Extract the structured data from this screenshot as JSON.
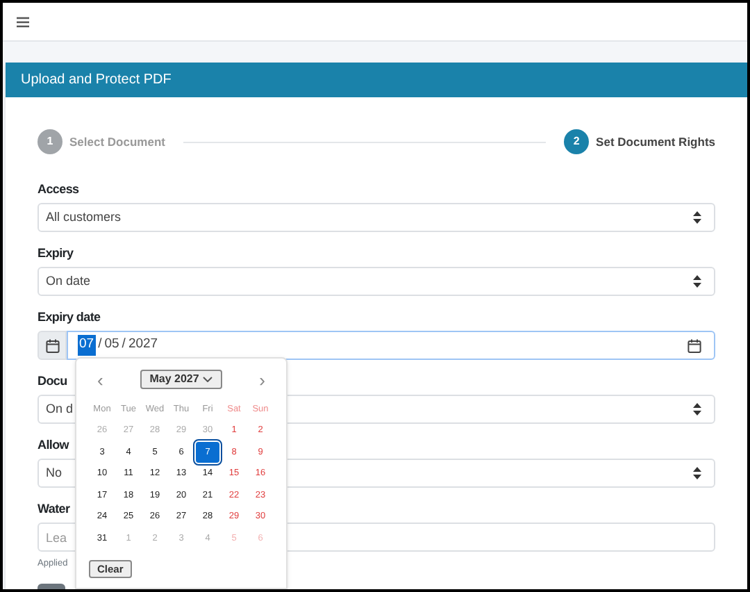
{
  "page_title": "Upload and Protect PDF",
  "steps": [
    {
      "number": "1",
      "label": "Select Document",
      "selected": false
    },
    {
      "number": "2",
      "label": "Set Document Rights",
      "selected": true
    }
  ],
  "fields": [
    {
      "kind": "select",
      "label": "Access",
      "value": "All customers"
    },
    {
      "kind": "select",
      "label": "Expiry",
      "value": "On date"
    },
    {
      "kind": "date",
      "label": "Expiry date",
      "separator": "/",
      "segments": [
        {
          "text": "07",
          "selected": true
        },
        {
          "text": "05",
          "selected": false
        },
        {
          "text": "2027",
          "selected": false
        }
      ]
    },
    {
      "kind": "select",
      "label": "Docu",
      "value": "On d"
    },
    {
      "kind": "select",
      "label": "Allow",
      "value": "No"
    },
    {
      "kind": "text",
      "label": "Water",
      "placeholder": "Lea",
      "help": "Applied"
    }
  ],
  "calendar": {
    "prev": "‹",
    "next": "›",
    "month": "May 2027",
    "clear": "Clear",
    "weekdays": [
      {
        "label": "Mon",
        "weekend": false
      },
      {
        "label": "Tue",
        "weekend": false
      },
      {
        "label": "Wed",
        "weekend": false
      },
      {
        "label": "Thu",
        "weekend": false
      },
      {
        "label": "Fri",
        "weekend": false
      },
      {
        "label": "Sat",
        "weekend": true
      },
      {
        "label": "Sun",
        "weekend": true
      }
    ],
    "days": [
      {
        "day": "26",
        "outside": true,
        "weekend": false,
        "selected": false
      },
      {
        "day": "27",
        "outside": true,
        "weekend": false,
        "selected": false
      },
      {
        "day": "28",
        "outside": true,
        "weekend": false,
        "selected": false
      },
      {
        "day": "29",
        "outside": true,
        "weekend": false,
        "selected": false
      },
      {
        "day": "30",
        "outside": true,
        "weekend": false,
        "selected": false
      },
      {
        "day": "1",
        "outside": false,
        "weekend": true,
        "selected": false
      },
      {
        "day": "2",
        "outside": false,
        "weekend": true,
        "selected": false
      },
      {
        "day": "3",
        "outside": false,
        "weekend": false,
        "selected": false
      },
      {
        "day": "4",
        "outside": false,
        "weekend": false,
        "selected": false
      },
      {
        "day": "5",
        "outside": false,
        "weekend": false,
        "selected": false
      },
      {
        "day": "6",
        "outside": false,
        "weekend": false,
        "selected": false
      },
      {
        "day": "7",
        "outside": false,
        "weekend": false,
        "selected": true
      },
      {
        "day": "8",
        "outside": false,
        "weekend": true,
        "selected": false
      },
      {
        "day": "9",
        "outside": false,
        "weekend": true,
        "selected": false
      },
      {
        "day": "10",
        "outside": false,
        "weekend": false,
        "selected": false
      },
      {
        "day": "11",
        "outside": false,
        "weekend": false,
        "selected": false
      },
      {
        "day": "12",
        "outside": false,
        "weekend": false,
        "selected": false
      },
      {
        "day": "13",
        "outside": false,
        "weekend": false,
        "selected": false
      },
      {
        "day": "14",
        "outside": false,
        "weekend": false,
        "selected": false
      },
      {
        "day": "15",
        "outside": false,
        "weekend": true,
        "selected": false
      },
      {
        "day": "16",
        "outside": false,
        "weekend": true,
        "selected": false
      },
      {
        "day": "17",
        "outside": false,
        "weekend": false,
        "selected": false
      },
      {
        "day": "18",
        "outside": false,
        "weekend": false,
        "selected": false
      },
      {
        "day": "19",
        "outside": false,
        "weekend": false,
        "selected": false
      },
      {
        "day": "20",
        "outside": false,
        "weekend": false,
        "selected": false
      },
      {
        "day": "21",
        "outside": false,
        "weekend": false,
        "selected": false
      },
      {
        "day": "22",
        "outside": false,
        "weekend": true,
        "selected": false
      },
      {
        "day": "23",
        "outside": false,
        "weekend": true,
        "selected": false
      },
      {
        "day": "24",
        "outside": false,
        "weekend": false,
        "selected": false
      },
      {
        "day": "25",
        "outside": false,
        "weekend": false,
        "selected": false
      },
      {
        "day": "26",
        "outside": false,
        "weekend": false,
        "selected": false
      },
      {
        "day": "27",
        "outside": false,
        "weekend": false,
        "selected": false
      },
      {
        "day": "28",
        "outside": false,
        "weekend": false,
        "selected": false
      },
      {
        "day": "29",
        "outside": false,
        "weekend": true,
        "selected": false
      },
      {
        "day": "30",
        "outside": false,
        "weekend": true,
        "selected": false
      },
      {
        "day": "31",
        "outside": false,
        "weekend": false,
        "selected": false
      },
      {
        "day": "1",
        "outside": true,
        "weekend": false,
        "selected": false
      },
      {
        "day": "2",
        "outside": true,
        "weekend": false,
        "selected": false
      },
      {
        "day": "3",
        "outside": true,
        "weekend": false,
        "selected": false
      },
      {
        "day": "4",
        "outside": true,
        "weekend": false,
        "selected": false
      },
      {
        "day": "5",
        "outside": true,
        "weekend": true,
        "selected": false
      },
      {
        "day": "6",
        "outside": true,
        "weekend": true,
        "selected": false
      }
    ]
  }
}
